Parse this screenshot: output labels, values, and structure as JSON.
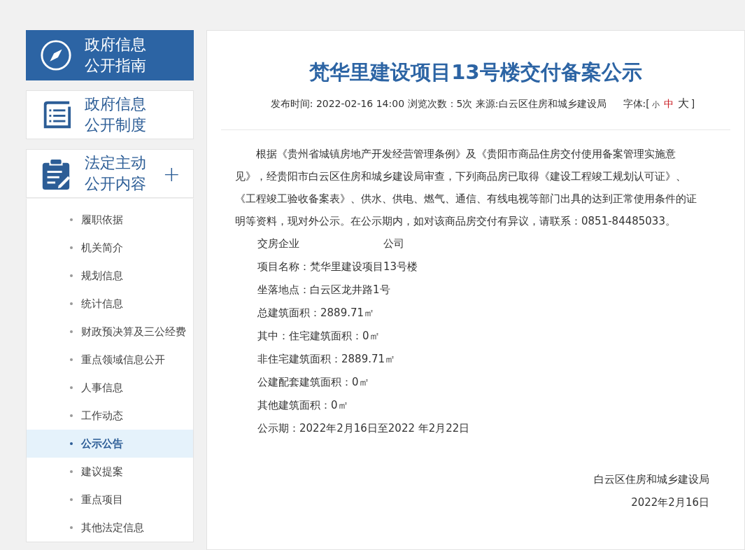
{
  "sidebar": {
    "headers": [
      {
        "kind": "compass",
        "line1": "政府信息",
        "line2": "公开指南",
        "selected": true
      },
      {
        "kind": "book",
        "line1": "政府信息",
        "line2": "公开制度",
        "selected": false
      },
      {
        "kind": "clipboard",
        "line1": "法定主动",
        "line2": "公开内容",
        "selected": false,
        "expander": "+"
      }
    ],
    "items": [
      {
        "label": "履职依据",
        "selected": false
      },
      {
        "label": "机关简介",
        "selected": false
      },
      {
        "label": "规划信息",
        "selected": false
      },
      {
        "label": "统计信息",
        "selected": false
      },
      {
        "label": "财政预决算及三公经费",
        "selected": false
      },
      {
        "label": "重点领域信息公开",
        "selected": false
      },
      {
        "label": "人事信息",
        "selected": false
      },
      {
        "label": "工作动态",
        "selected": false
      },
      {
        "label": "公示公告",
        "selected": true
      },
      {
        "label": "建议提案",
        "selected": false
      },
      {
        "label": "重点项目",
        "selected": false
      },
      {
        "label": "其他法定信息",
        "selected": false
      }
    ]
  },
  "article": {
    "title": "梵华里建设项目13号楼交付备案公示",
    "meta": "发布时间: 2022-02-16 14:00 浏览次数：5次 来源:白云区住房和城乡建设局",
    "font_label": "字体:[",
    "font_sizes": [
      {
        "label": "小",
        "kind": "small",
        "selected": false
      },
      {
        "label": "中",
        "kind": "medium",
        "selected": true
      },
      {
        "label": "大",
        "kind": "large",
        "selected": false
      }
    ],
    "font_close": "]",
    "paragraph": "根据《贵州省城镇房地产开发经营管理条例》及《贵阳市商品住房交付使用备案管理实施意见》，经贵阳市白云区住房和城乡建设局审查，下列商品房已取得《建设工程竣工规划认可证》、《工程竣工验收备案表》、供水、供电、燃气、通信、有线电视等部门出具的达到正常使用条件的证明等资料，现对外公示。在公示期内，如对该商品房交付有异议，请联系：0851-84485033。",
    "fields": [
      {
        "parts": [
          "交房企业",
          "公司"
        ]
      },
      {
        "parts": [
          "项目名称：梵华里建设项目13号楼"
        ]
      },
      {
        "parts": [
          "坐落地点：白云区龙井路1号"
        ]
      },
      {
        "parts": [
          "总建筑面积：2889.71㎡"
        ]
      },
      {
        "parts": [
          "其中：住宅建筑面积：0㎡"
        ]
      },
      {
        "parts": [
          "非住宅建筑面积：2889.71㎡"
        ]
      },
      {
        "parts": [
          "公建配套建筑面积：0㎡"
        ]
      },
      {
        "parts": [
          "其他建筑面积：0㎡"
        ]
      },
      {
        "parts": [
          "公示期：2022年2月16日至2022 年2月22日"
        ]
      }
    ],
    "signature": [
      "白云区住房和城乡建设局",
      "2022年2月16日"
    ]
  }
}
